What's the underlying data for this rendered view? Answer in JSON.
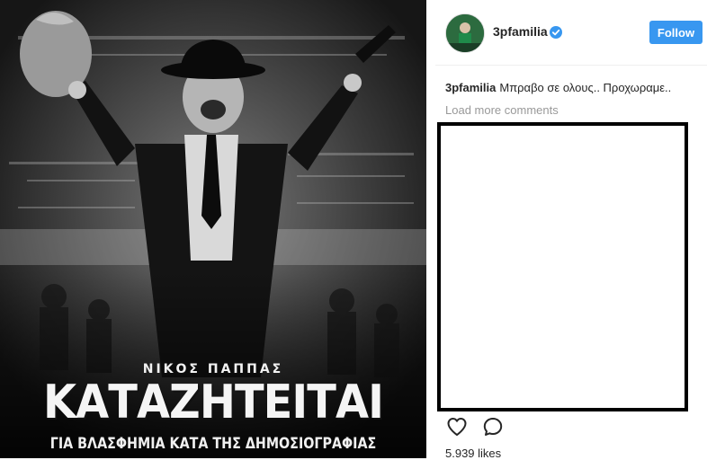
{
  "post": {
    "poster": {
      "name_line": "ΝΙΚΟΣ ΠΑΠΠΑΣ",
      "headline": "ΚΑΤΑΖΗΤΕΙΤΑΙ",
      "subline": "ΓΙΑ ΒΛΑΣΦΗΜΙΑ ΚΑΤΑ ΤΗΣ ΔΗΜΟΣΙΟΓΡΑΦΙΑΣ"
    }
  },
  "header": {
    "username": "3pfamilia",
    "follow_label": "Follow",
    "verified_icon": "verified-badge",
    "accent": "#3897f0"
  },
  "caption": {
    "username": "3pfamilia",
    "text": "Μπραβο σε ολους.. Προχωραμε.."
  },
  "comments": {
    "load_more": "Load more comments"
  },
  "actions": {
    "like_icon": "heart-outline",
    "comment_icon": "speech-bubble-outline",
    "likes_text": "5.939 likes"
  }
}
